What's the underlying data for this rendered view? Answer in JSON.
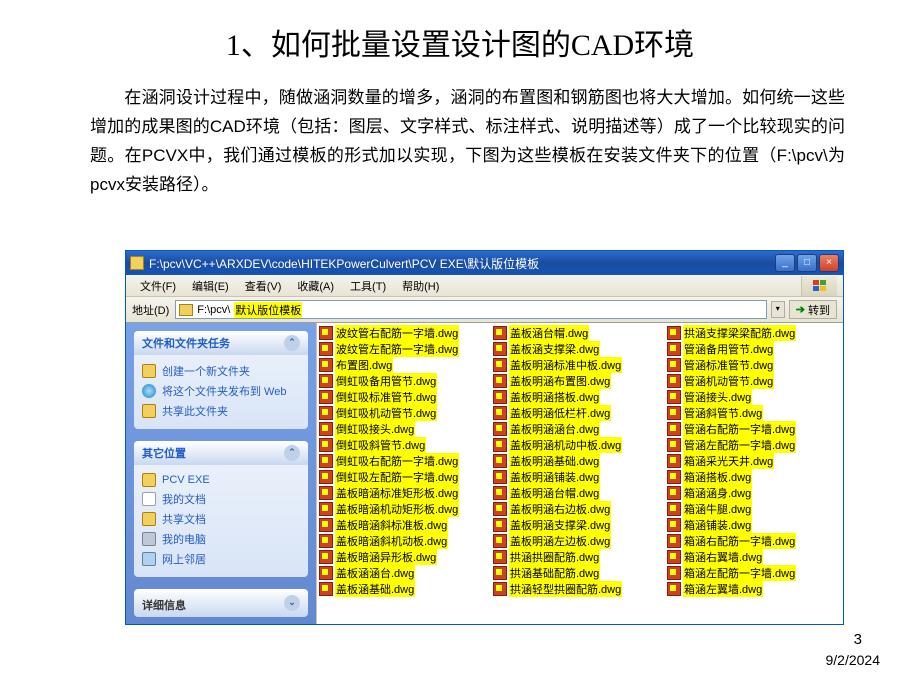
{
  "slide": {
    "title": "1、如何批量设置设计图的CAD环境",
    "body": "　　在涵洞设计过程中，随做涵洞数量的增多，涵洞的布置图和钢筋图也将大大增加。如何统一这些增加的成果图的CAD环境（包括：图层、文字样式、标注样式、说明描述等）成了一个比较现实的问题。在PCVX中，我们通过模板的形式加以实现，下图为这些模板在安装文件夹下的位置（F:\\pcv\\为pcvx安装路径）。",
    "page_number": "3",
    "date": "9/2/2024"
  },
  "window": {
    "title_path": "F:\\pcv\\VC++\\ARXDEV\\code\\HITEKPowerCulvert\\PCV EXE\\默认版位模板",
    "menu": {
      "file": "文件(F)",
      "edit": "编辑(E)",
      "view": "查看(V)",
      "fav": "收藏(A)",
      "tools": "工具(T)",
      "help": "帮助(H)"
    },
    "address": {
      "label": "地址(D)",
      "path_prefix": "F:\\pcv\\",
      "path_highlight": "默认版位模板",
      "go": "转到"
    },
    "sidebar": {
      "tasks": {
        "title": "文件和文件夹任务",
        "items": [
          "创建一个新文件夹",
          "将这个文件夹发布到 Web",
          "共享此文件夹"
        ]
      },
      "other": {
        "title": "其它位置",
        "items": [
          "PCV EXE",
          "我的文档",
          "共享文档",
          "我的电脑",
          "网上邻居"
        ]
      },
      "details": {
        "title": "详细信息"
      }
    }
  },
  "files": {
    "col1": [
      "波纹管右配筋一字墙.dwg",
      "波纹管左配筋一字墙.dwg",
      "布置图.dwg",
      "倒虹吸备用管节.dwg",
      "倒虹吸标准管节.dwg",
      "倒虹吸机动管节.dwg",
      "倒虹吸接头.dwg",
      "倒虹吸斜管节.dwg",
      "倒虹吸右配筋一字墙.dwg",
      "倒虹吸左配筋一字墙.dwg",
      "盖板暗涵标准矩形板.dwg",
      "盖板暗涵机动矩形板.dwg",
      "盖板暗涵斜标准板.dwg",
      "盖板暗涵斜机动板.dwg",
      "盖板暗涵异形板.dwg",
      "盖板涵涵台.dwg",
      "盖板涵基础.dwg"
    ],
    "col2": [
      "盖板涵台帽.dwg",
      "盖板涵支撑梁.dwg",
      "盖板明涵标准中板.dwg",
      "盖板明涵布置图.dwg",
      "盖板明涵搭板.dwg",
      "盖板明涵低栏杆.dwg",
      "盖板明涵涵台.dwg",
      "盖板明涵机动中板.dwg",
      "盖板明涵基础.dwg",
      "盖板明涵铺装.dwg",
      "盖板明涵台帽.dwg",
      "盖板明涵右边板.dwg",
      "盖板明涵支撑梁.dwg",
      "盖板明涵左边板.dwg",
      "拱涵拱圈配筋.dwg",
      "拱涵基础配筋.dwg",
      "拱涵轻型拱圈配筋.dwg"
    ],
    "col3": [
      "拱涵支撑梁梁配筋.dwg",
      "管涵备用管节.dwg",
      "管涵标准管节.dwg",
      "管涵机动管节.dwg",
      "管涵接头.dwg",
      "管涵斜管节.dwg",
      "管涵右配筋一字墙.dwg",
      "管涵左配筋一字墙.dwg",
      "箱涵采光天井.dwg",
      "箱涵搭板.dwg",
      "箱涵涵身.dwg",
      "箱涵牛腿.dwg",
      "箱涵铺装.dwg",
      "箱涵右配筋一字墙.dwg",
      "箱涵右翼墙.dwg",
      "箱涵左配筋一字墙.dwg",
      "箱涵左翼墙.dwg"
    ]
  }
}
